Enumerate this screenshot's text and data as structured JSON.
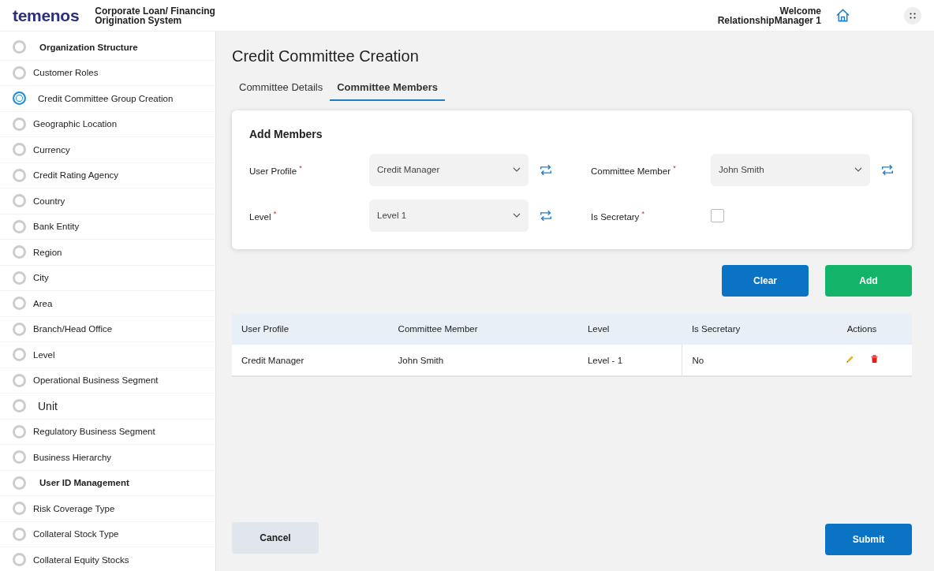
{
  "header": {
    "logo": "temenos",
    "app_title": "Corporate Loan/ Financing Origination System",
    "welcome": "Welcome",
    "user": "RelationshipManager 1"
  },
  "sidebar": {
    "items": [
      {
        "label": "Organization Structure",
        "kind": "heading",
        "selected": false
      },
      {
        "label": "Customer Roles",
        "kind": "normal",
        "selected": false
      },
      {
        "label": "Credit  Committee Group Creation",
        "kind": "normal",
        "selected": true
      },
      {
        "label": "Geographic Location",
        "kind": "normal",
        "selected": false
      },
      {
        "label": "Currency",
        "kind": "normal",
        "selected": false
      },
      {
        "label": "Credit Rating Agency",
        "kind": "normal",
        "selected": false
      },
      {
        "label": "Country",
        "kind": "normal",
        "selected": false
      },
      {
        "label": "Bank Entity",
        "kind": "normal",
        "selected": false
      },
      {
        "label": "Region",
        "kind": "normal",
        "selected": false
      },
      {
        "label": "City",
        "kind": "normal",
        "selected": false
      },
      {
        "label": "Area",
        "kind": "normal",
        "selected": false
      },
      {
        "label": "Branch/Head Office",
        "kind": "normal",
        "selected": false
      },
      {
        "label": "Level",
        "kind": "normal",
        "selected": false
      },
      {
        "label": "Operational Business Segment",
        "kind": "normal",
        "selected": false
      },
      {
        "label": "Unit",
        "kind": "large",
        "selected": false
      },
      {
        "label": "Regulatory Business Segment",
        "kind": "normal",
        "selected": false
      },
      {
        "label": "Business Hierarchy",
        "kind": "normal",
        "selected": false
      },
      {
        "label": "User ID Management",
        "kind": "heading",
        "selected": false
      },
      {
        "label": "Risk Coverage Type",
        "kind": "normal",
        "selected": false
      },
      {
        "label": "Collateral Stock Type",
        "kind": "normal",
        "selected": false
      },
      {
        "label": "Collateral Equity Stocks",
        "kind": "normal",
        "selected": false
      }
    ]
  },
  "page_title": "Credit Committee Creation",
  "tabs": [
    {
      "label": "Committee Details",
      "selected": false
    },
    {
      "label": "Committee Members",
      "selected": true
    }
  ],
  "form": {
    "title": "Add Members",
    "fields": [
      {
        "label": "User Profile",
        "required_mark": "*",
        "kind": "select",
        "value": "Credit Manager"
      },
      {
        "label": "Committee Member",
        "required_mark": "*",
        "kind": "select",
        "value": "John Smith"
      },
      {
        "label": "Level",
        "required_mark": "*",
        "kind": "select",
        "value": "Level 1"
      },
      {
        "label": "Is Secretary",
        "required_mark": "*",
        "kind": "checkbox",
        "checked": false
      }
    ]
  },
  "form_buttons": [
    "Clear",
    "Add"
  ],
  "table": {
    "columns": [
      "User Profile",
      "Committee Member",
      "Level",
      "Is Secretary",
      "Actions"
    ],
    "rows": [
      [
        "Credit Manager",
        "John Smith",
        "Level - 1",
        "No"
      ]
    ]
  },
  "footer_buttons": [
    "Cancel",
    "Submit"
  ]
}
